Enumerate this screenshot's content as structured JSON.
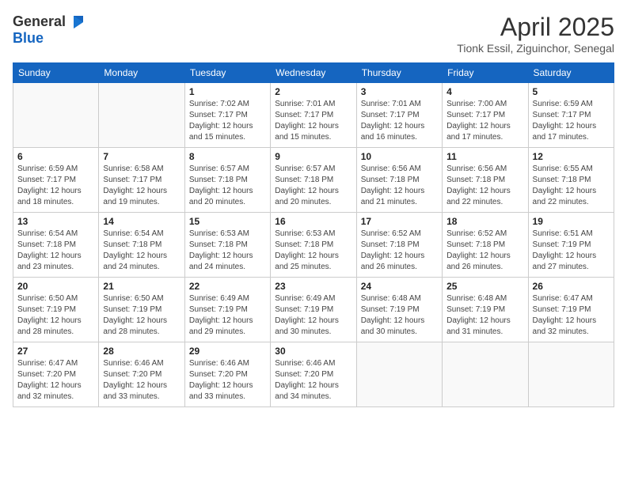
{
  "logo": {
    "general": "General",
    "blue": "Blue"
  },
  "title": {
    "month_year": "April 2025",
    "location": "Tionk Essil, Ziguinchor, Senegal"
  },
  "days_of_week": [
    "Sunday",
    "Monday",
    "Tuesday",
    "Wednesday",
    "Thursday",
    "Friday",
    "Saturday"
  ],
  "weeks": [
    [
      {
        "day": "",
        "sunrise": "",
        "sunset": "",
        "daylight": ""
      },
      {
        "day": "",
        "sunrise": "",
        "sunset": "",
        "daylight": ""
      },
      {
        "day": "1",
        "sunrise": "Sunrise: 7:02 AM",
        "sunset": "Sunset: 7:17 PM",
        "daylight": "Daylight: 12 hours and 15 minutes."
      },
      {
        "day": "2",
        "sunrise": "Sunrise: 7:01 AM",
        "sunset": "Sunset: 7:17 PM",
        "daylight": "Daylight: 12 hours and 15 minutes."
      },
      {
        "day": "3",
        "sunrise": "Sunrise: 7:01 AM",
        "sunset": "Sunset: 7:17 PM",
        "daylight": "Daylight: 12 hours and 16 minutes."
      },
      {
        "day": "4",
        "sunrise": "Sunrise: 7:00 AM",
        "sunset": "Sunset: 7:17 PM",
        "daylight": "Daylight: 12 hours and 17 minutes."
      },
      {
        "day": "5",
        "sunrise": "Sunrise: 6:59 AM",
        "sunset": "Sunset: 7:17 PM",
        "daylight": "Daylight: 12 hours and 17 minutes."
      }
    ],
    [
      {
        "day": "6",
        "sunrise": "Sunrise: 6:59 AM",
        "sunset": "Sunset: 7:17 PM",
        "daylight": "Daylight: 12 hours and 18 minutes."
      },
      {
        "day": "7",
        "sunrise": "Sunrise: 6:58 AM",
        "sunset": "Sunset: 7:17 PM",
        "daylight": "Daylight: 12 hours and 19 minutes."
      },
      {
        "day": "8",
        "sunrise": "Sunrise: 6:57 AM",
        "sunset": "Sunset: 7:18 PM",
        "daylight": "Daylight: 12 hours and 20 minutes."
      },
      {
        "day": "9",
        "sunrise": "Sunrise: 6:57 AM",
        "sunset": "Sunset: 7:18 PM",
        "daylight": "Daylight: 12 hours and 20 minutes."
      },
      {
        "day": "10",
        "sunrise": "Sunrise: 6:56 AM",
        "sunset": "Sunset: 7:18 PM",
        "daylight": "Daylight: 12 hours and 21 minutes."
      },
      {
        "day": "11",
        "sunrise": "Sunrise: 6:56 AM",
        "sunset": "Sunset: 7:18 PM",
        "daylight": "Daylight: 12 hours and 22 minutes."
      },
      {
        "day": "12",
        "sunrise": "Sunrise: 6:55 AM",
        "sunset": "Sunset: 7:18 PM",
        "daylight": "Daylight: 12 hours and 22 minutes."
      }
    ],
    [
      {
        "day": "13",
        "sunrise": "Sunrise: 6:54 AM",
        "sunset": "Sunset: 7:18 PM",
        "daylight": "Daylight: 12 hours and 23 minutes."
      },
      {
        "day": "14",
        "sunrise": "Sunrise: 6:54 AM",
        "sunset": "Sunset: 7:18 PM",
        "daylight": "Daylight: 12 hours and 24 minutes."
      },
      {
        "day": "15",
        "sunrise": "Sunrise: 6:53 AM",
        "sunset": "Sunset: 7:18 PM",
        "daylight": "Daylight: 12 hours and 24 minutes."
      },
      {
        "day": "16",
        "sunrise": "Sunrise: 6:53 AM",
        "sunset": "Sunset: 7:18 PM",
        "daylight": "Daylight: 12 hours and 25 minutes."
      },
      {
        "day": "17",
        "sunrise": "Sunrise: 6:52 AM",
        "sunset": "Sunset: 7:18 PM",
        "daylight": "Daylight: 12 hours and 26 minutes."
      },
      {
        "day": "18",
        "sunrise": "Sunrise: 6:52 AM",
        "sunset": "Sunset: 7:18 PM",
        "daylight": "Daylight: 12 hours and 26 minutes."
      },
      {
        "day": "19",
        "sunrise": "Sunrise: 6:51 AM",
        "sunset": "Sunset: 7:19 PM",
        "daylight": "Daylight: 12 hours and 27 minutes."
      }
    ],
    [
      {
        "day": "20",
        "sunrise": "Sunrise: 6:50 AM",
        "sunset": "Sunset: 7:19 PM",
        "daylight": "Daylight: 12 hours and 28 minutes."
      },
      {
        "day": "21",
        "sunrise": "Sunrise: 6:50 AM",
        "sunset": "Sunset: 7:19 PM",
        "daylight": "Daylight: 12 hours and 28 minutes."
      },
      {
        "day": "22",
        "sunrise": "Sunrise: 6:49 AM",
        "sunset": "Sunset: 7:19 PM",
        "daylight": "Daylight: 12 hours and 29 minutes."
      },
      {
        "day": "23",
        "sunrise": "Sunrise: 6:49 AM",
        "sunset": "Sunset: 7:19 PM",
        "daylight": "Daylight: 12 hours and 30 minutes."
      },
      {
        "day": "24",
        "sunrise": "Sunrise: 6:48 AM",
        "sunset": "Sunset: 7:19 PM",
        "daylight": "Daylight: 12 hours and 30 minutes."
      },
      {
        "day": "25",
        "sunrise": "Sunrise: 6:48 AM",
        "sunset": "Sunset: 7:19 PM",
        "daylight": "Daylight: 12 hours and 31 minutes."
      },
      {
        "day": "26",
        "sunrise": "Sunrise: 6:47 AM",
        "sunset": "Sunset: 7:19 PM",
        "daylight": "Daylight: 12 hours and 32 minutes."
      }
    ],
    [
      {
        "day": "27",
        "sunrise": "Sunrise: 6:47 AM",
        "sunset": "Sunset: 7:20 PM",
        "daylight": "Daylight: 12 hours and 32 minutes."
      },
      {
        "day": "28",
        "sunrise": "Sunrise: 6:46 AM",
        "sunset": "Sunset: 7:20 PM",
        "daylight": "Daylight: 12 hours and 33 minutes."
      },
      {
        "day": "29",
        "sunrise": "Sunrise: 6:46 AM",
        "sunset": "Sunset: 7:20 PM",
        "daylight": "Daylight: 12 hours and 33 minutes."
      },
      {
        "day": "30",
        "sunrise": "Sunrise: 6:46 AM",
        "sunset": "Sunset: 7:20 PM",
        "daylight": "Daylight: 12 hours and 34 minutes."
      },
      {
        "day": "",
        "sunrise": "",
        "sunset": "",
        "daylight": ""
      },
      {
        "day": "",
        "sunrise": "",
        "sunset": "",
        "daylight": ""
      },
      {
        "day": "",
        "sunrise": "",
        "sunset": "",
        "daylight": ""
      }
    ]
  ]
}
